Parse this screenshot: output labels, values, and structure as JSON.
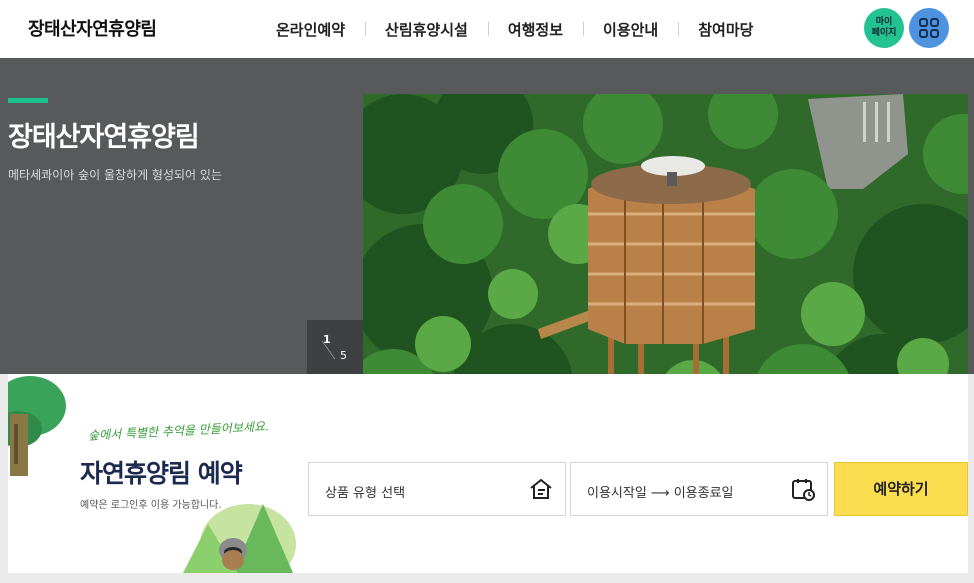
{
  "header": {
    "logo": "장태산자연휴양림",
    "nav": [
      "온라인예약",
      "산림휴양시설",
      "여행정보",
      "이용안내",
      "참여마당"
    ],
    "mypage_line1": "마이",
    "mypage_line2": "페이지"
  },
  "hero": {
    "title": "장태산자연휴양림",
    "subtitle": "메타세콰이아 숲이 울창하게 형성되어 있는",
    "slide_current": "1",
    "slide_total": "5"
  },
  "reservation": {
    "script": "숲에서 특별한 추억을 만들어보세요.",
    "title": "자연휴양림 예약",
    "note": "예약은 로그인후 이용 가능합니다.",
    "product_placeholder": "상품 유형 선택",
    "date_placeholder": "이용시작일 ⟶ 이용종료일",
    "submit_label": "예약하기"
  },
  "icons": {
    "menu": "grid-icon",
    "prev": "arrow-left-icon",
    "next": "arrow-right-icon",
    "product": "house-list-icon",
    "date": "calendar-clock-icon"
  },
  "colors": {
    "hero_bg": "#58595b",
    "accent_green": "#1dbf8b",
    "mypage_button": "#23c391",
    "menu_button": "#4e93e0",
    "reserve_button": "#fddd50"
  }
}
